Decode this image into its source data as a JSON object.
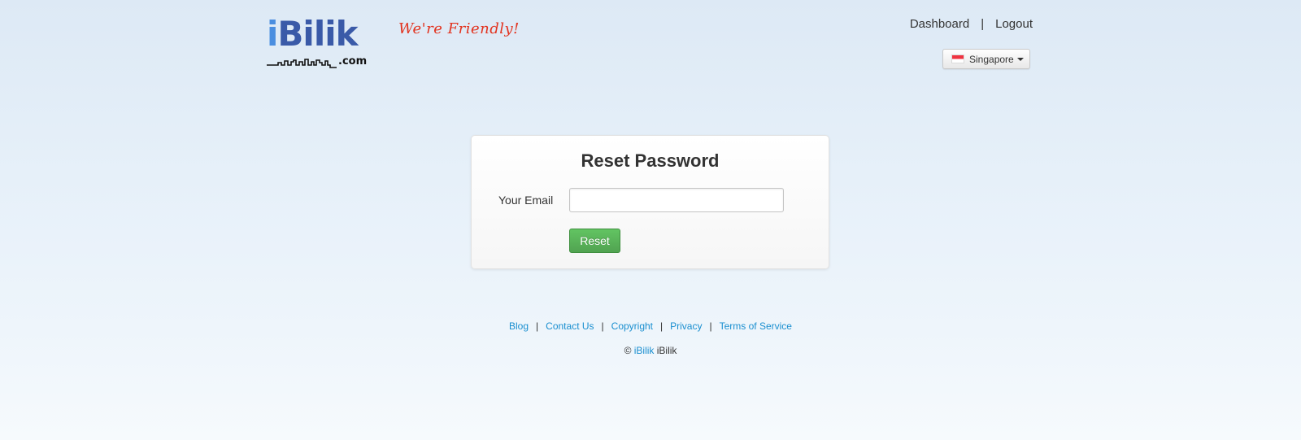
{
  "brand": {
    "logo_name": "iBilik",
    "logo_i": "i",
    "logo_rest": "Bilik",
    "logo_suffix": ".com",
    "tagline": "We're Friendly!"
  },
  "topnav": {
    "dashboard": "Dashboard",
    "separator": "|",
    "logout": "Logout"
  },
  "country_selector": {
    "selected": "Singapore",
    "flag_icon": "singapore-flag-icon"
  },
  "reset_form": {
    "title": "Reset Password",
    "email_label": "Your Email",
    "email_value": "",
    "email_placeholder": "",
    "submit_label": "Reset"
  },
  "footer": {
    "links": [
      "Blog",
      "Contact Us",
      "Copyright",
      "Privacy",
      "Terms of Service"
    ],
    "separator": "|",
    "copyright_symbol": "©",
    "copyright_link": "iBilik",
    "copyright_text": "iBilik"
  },
  "colors": {
    "link": "#1a8fd0",
    "logo_blue": "#3a5aa8",
    "logo_i": "#4a8ee0",
    "tagline_red": "#e2331f",
    "reset_green": "#5bb75b"
  }
}
